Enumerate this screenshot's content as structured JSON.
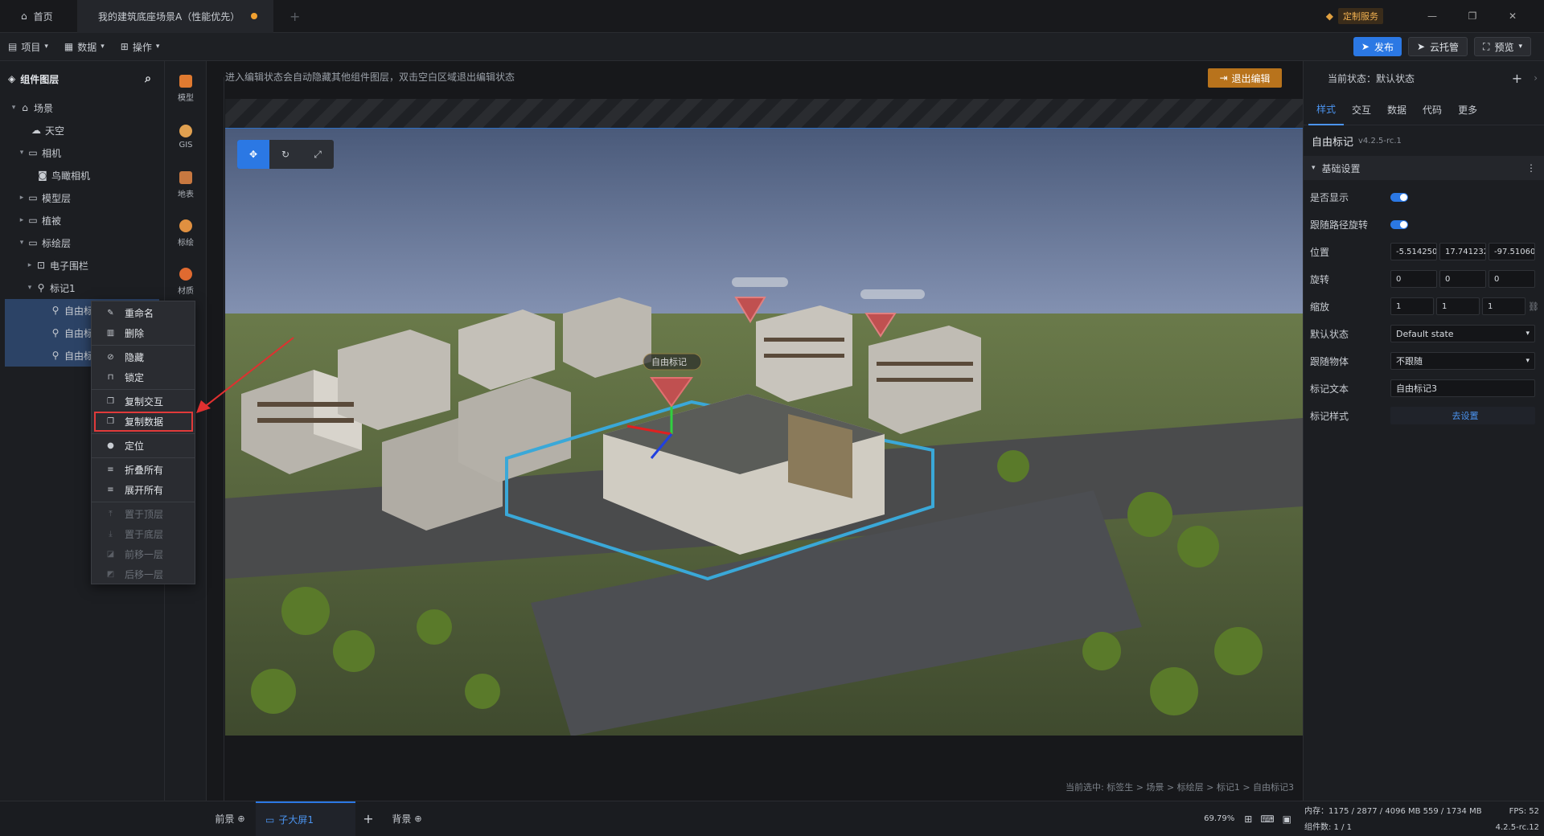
{
  "titlebar": {
    "home_tab": "首页",
    "doc_tab": "我的建筑底座场景A（性能优先）",
    "custom_service": "定制服务"
  },
  "menubar": {
    "project": "项目",
    "data": "数据",
    "operate": "操作",
    "publish": "发布",
    "cloud": "云托管",
    "preview": "预览"
  },
  "layers": {
    "title": "组件图层",
    "items": [
      {
        "label": "场景"
      },
      {
        "label": "天空"
      },
      {
        "label": "相机"
      },
      {
        "label": "鸟瞰相机"
      },
      {
        "label": "模型层"
      },
      {
        "label": "植被"
      },
      {
        "label": "标绘层"
      },
      {
        "label": "电子围栏"
      },
      {
        "label": "标记1"
      },
      {
        "label": "自由标记1"
      },
      {
        "label": "自由标记2"
      },
      {
        "label": "自由标记3"
      }
    ]
  },
  "tools": [
    {
      "label": "模型"
    },
    {
      "label": "GIS"
    },
    {
      "label": "地表"
    },
    {
      "label": "标绘"
    },
    {
      "label": "材质"
    }
  ],
  "canvas": {
    "hint": "进入编辑状态会自动隐藏其他组件图层，双击空白区域退出编辑状态",
    "exit_edit": "退出编辑",
    "marker_label": "自由标记",
    "breadcrumb": "当前选中: 标签生 > 场景 > 标绘层 > 标记1 > 自由标记3"
  },
  "context_menu": {
    "items": [
      {
        "label": "重命名",
        "icon": "pencil-icon"
      },
      {
        "label": "删除",
        "icon": "trash-icon"
      },
      {
        "label": "隐藏",
        "icon": "eye-off-icon"
      },
      {
        "label": "锁定",
        "icon": "lock-icon"
      },
      {
        "label": "复制交互",
        "icon": "copy-icon"
      },
      {
        "label": "复制数据",
        "icon": "copy-icon"
      },
      {
        "label": "定位",
        "icon": "location-icon"
      },
      {
        "label": "折叠所有",
        "icon": "collapse-icon"
      },
      {
        "label": "展开所有",
        "icon": "expand-icon"
      },
      {
        "label": "置于顶层",
        "icon": "to-top-icon"
      },
      {
        "label": "置于底层",
        "icon": "to-bottom-icon"
      },
      {
        "label": "前移一层",
        "icon": "forward-icon"
      },
      {
        "label": "后移一层",
        "icon": "backward-icon"
      }
    ]
  },
  "props": {
    "state_label": "当前状态：默认状态",
    "tabs": [
      "样式",
      "交互",
      "数据",
      "代码",
      "更多"
    ],
    "component_name": "自由标记",
    "version": "v4.2.5-rc.1",
    "section": "基础设置",
    "rows": {
      "visible": "是否显示",
      "follow_rotate": "跟随路径旋转",
      "position": "位置",
      "rotation": "旋转",
      "scale": "缩放",
      "default_state": "默认状态",
      "follow_object": "跟随物体",
      "marker_text": "标记文本",
      "marker_style": "标记样式"
    },
    "values": {
      "pos_x": "-5.514250",
      "pos_y": "17.7412321",
      "pos_z": "-97.51060",
      "rot_x": "0",
      "rot_y": "0",
      "rot_z": "0",
      "scale_x": "1",
      "scale_y": "1",
      "scale_z": "1",
      "default_state": "Default state",
      "follow_object": "不跟随",
      "marker_text": "自由标记3",
      "marker_style": "去设置"
    }
  },
  "bottom": {
    "front": "前景",
    "subscreen": "子大屏1",
    "background": "背景",
    "zoom": "69.79%",
    "memory": "内存：1175 / 2877 / 4096 MB  559 / 1734 MB",
    "fps": "FPS: 52",
    "count": "组件数: 1 / 1",
    "version": "4.2.5-rc.12"
  },
  "colors": {
    "accent": "#2b78e4",
    "warning": "#b8731c",
    "highlight_border": "#e03a3a",
    "selection": "#2c4366"
  }
}
